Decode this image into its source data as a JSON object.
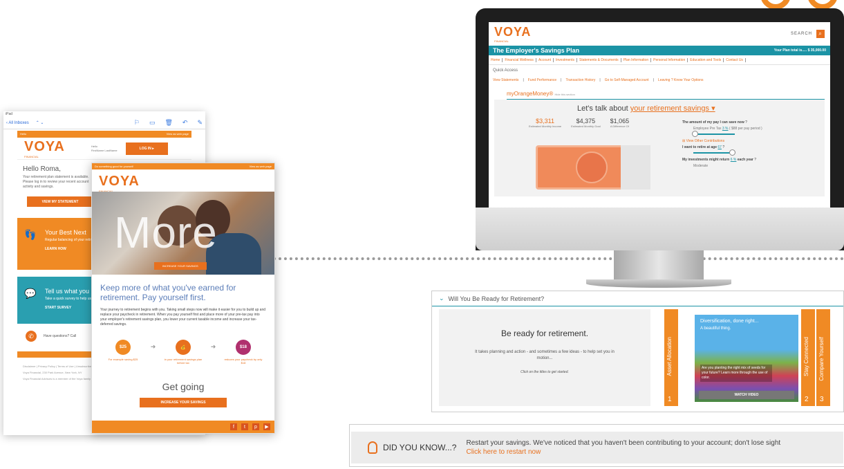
{
  "brand": {
    "logo": "VOYA",
    "logo_sub": "FINANCIAL",
    "orange": "#e8701e",
    "teal": "#1b93a5"
  },
  "tablet_email": {
    "status": "iPad",
    "back_label": "All Inboxes",
    "top_left": "Hello",
    "top_right": "View as web page",
    "hello_text": "Hello",
    "hello_name": "FirstName LastName",
    "login_button": "LOG IN",
    "greeting": "Hello Roma,",
    "body": "Your retirement plan statement is available. Please log in to review your recent account activity and savings.",
    "statement_button": "VIEW MY STATEMENT",
    "tile1_title": "Your Best Next",
    "tile1_body": "Regular balancing of your retirement savings can help you successfully manage...",
    "tile1_link": "LEARN HOW",
    "tile2_title": "Tell us what you",
    "tile2_body": "Take a quick survey to help us...",
    "tile2_link": "START SURVEY",
    "questions": "Have questions? Call",
    "footer_links": "Disclaimer | Privacy Policy | Terms of Use | Unsubscribe",
    "footer_address": "Voya Financial, 230 Park Avenue, New York, NY",
    "footer_member": "Voya Financial Advisors is a member of the Voya family"
  },
  "tablet_promo": {
    "top_left": "Do something good for yourself",
    "top_right": "View as web page",
    "hero_word": "More",
    "hero_button": "INCREASE YOUR SAVINGS",
    "headline": "Keep more of what you've earned for retirement. Pay yourself first.",
    "body": "Your journey to retirement begins with you. Taking small steps now will make it easier for you to build up and replace your paycheck in retirement. When you pay yourself first and place more of your pre-tax pay into your employer's retirement savings plan, you lower your current taxable income and increase your tax-deferred savings.",
    "steps": [
      {
        "value": "$25",
        "caption": "For example saving $25",
        "color": "#f08a24"
      },
      {
        "value": "",
        "caption": "in your retirement savings plan before tax",
        "color": "#e8701e"
      },
      {
        "value": "$18",
        "caption": "reduces your paycheck by only $18",
        "color": "#b0306e"
      }
    ],
    "get_going": "Get going",
    "increase_button": "INCREASE YOUR SAVINGS"
  },
  "monitor": {
    "search": "SEARCH",
    "plan_title": "The Employer's Savings Plan",
    "plan_total": "Your Plan total is..... $ 35,000.00",
    "nav": [
      "Home",
      "Financial Wellness",
      "Account",
      "Investments",
      "Statements & Documents",
      "Plan Information",
      "Personal Information",
      "Education and Tools",
      "Contact Us"
    ],
    "quick_access": "Quick Access",
    "quick_links": [
      "View Statements",
      "Fund Performance",
      "Transaction History",
      "Go to Self-Managed Account",
      "Leaving ? Know Your Options"
    ],
    "mom_title": "myOrangeMoney®",
    "mom_hide": "Hide this section",
    "talk_prefix": "Let's talk about",
    "talk_select": "your retirement savings",
    "stats": [
      {
        "value": "$3,311",
        "label": "Estimated Monthly Income"
      },
      {
        "value": "$4,375",
        "label": "Estimated Monthly Goal"
      },
      {
        "value": "$1,065",
        "label": "A Difference Of"
      }
    ],
    "save_label": "The amount of my pay I can save now",
    "pretax_label": "Employee Pre Tax",
    "pretax_value": "3 %",
    "pretax_note": "( $88 per pay period )",
    "other_contrib": "View Other Contributions",
    "retire_label": "I want to retire at age",
    "retire_value": "67",
    "return_label": "My investments might return",
    "return_value": "6 %",
    "return_suffix": "each year",
    "return_level": "Moderate"
  },
  "ready": {
    "title": "Will You Be Ready for Retirement?",
    "headline": "Be ready for retirement.",
    "body": "It takes planning and action - and sometimes a few ideas - to help set you in motion...",
    "click": "Click on the titles to get started.",
    "tab1": {
      "label": "Asset Allocation",
      "num": "1"
    },
    "tab2": {
      "label": "Stay Connected",
      "num": "2"
    },
    "tab3": {
      "label": "Compare Yourself",
      "num": "3"
    },
    "video_title": "Diversification, done right...",
    "video_sub": "A beautiful thing.",
    "video_question": "Are you planting the right mix of seeds for your future? Learn more through the use of color.",
    "video_button": "WATCH VIDEO"
  },
  "did_you_know": {
    "label": "DID YOU KNOW...?",
    "message": "Restart your savings. We've noticed that you haven't been contributing to your account; don't lose sight",
    "link": "Click here to restart now"
  }
}
